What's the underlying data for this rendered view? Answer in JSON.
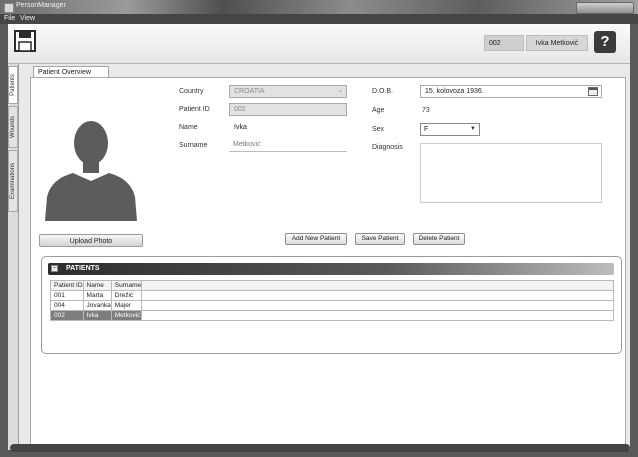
{
  "window": {
    "title": "PersonManager",
    "menu": [
      "File",
      "View"
    ]
  },
  "toolbar": {
    "record_id": "002",
    "record_name": "Ivka Metković",
    "help_label": "?"
  },
  "side_tabs": [
    "Patients",
    "Wounds",
    "Examinations"
  ],
  "doc_tab": "Patient Overview",
  "form": {
    "country_label": "Country",
    "country_value": "CROATIA",
    "patient_id_label": "Patient ID",
    "patient_id_value": "002",
    "name_label": "Name",
    "name_value": "Ivka",
    "surname_label": "Surname",
    "surname_value": "Metković",
    "dob_label": "D.O.B.",
    "dob_value": "15. kolovoza 1936.",
    "age_label": "Age",
    "age_value": "73",
    "sex_label": "Sex",
    "sex_value": "F",
    "diagnosis_label": "Diagnosis",
    "diagnosis_value": ""
  },
  "buttons": {
    "upload_photo": "Upload Photo",
    "add_new_patient": "Add New Patient",
    "save_patient": "Save Patient",
    "delete_patient": "Delete Patient"
  },
  "patients_panel": {
    "title": "PATIENTS",
    "columns": [
      "Patient ID",
      "Name",
      "Surname"
    ],
    "rows": [
      {
        "id": "001",
        "name": "Marta",
        "surname": "Drežić"
      },
      {
        "id": "004",
        "name": "Jovanka",
        "surname": "Majer"
      },
      {
        "id": "002",
        "name": "Ivka",
        "surname": "Metković"
      }
    ],
    "selected_row": 2
  },
  "colors": {
    "selected_row": "#7d7d7d",
    "panel_header": "#2c2c2c"
  }
}
